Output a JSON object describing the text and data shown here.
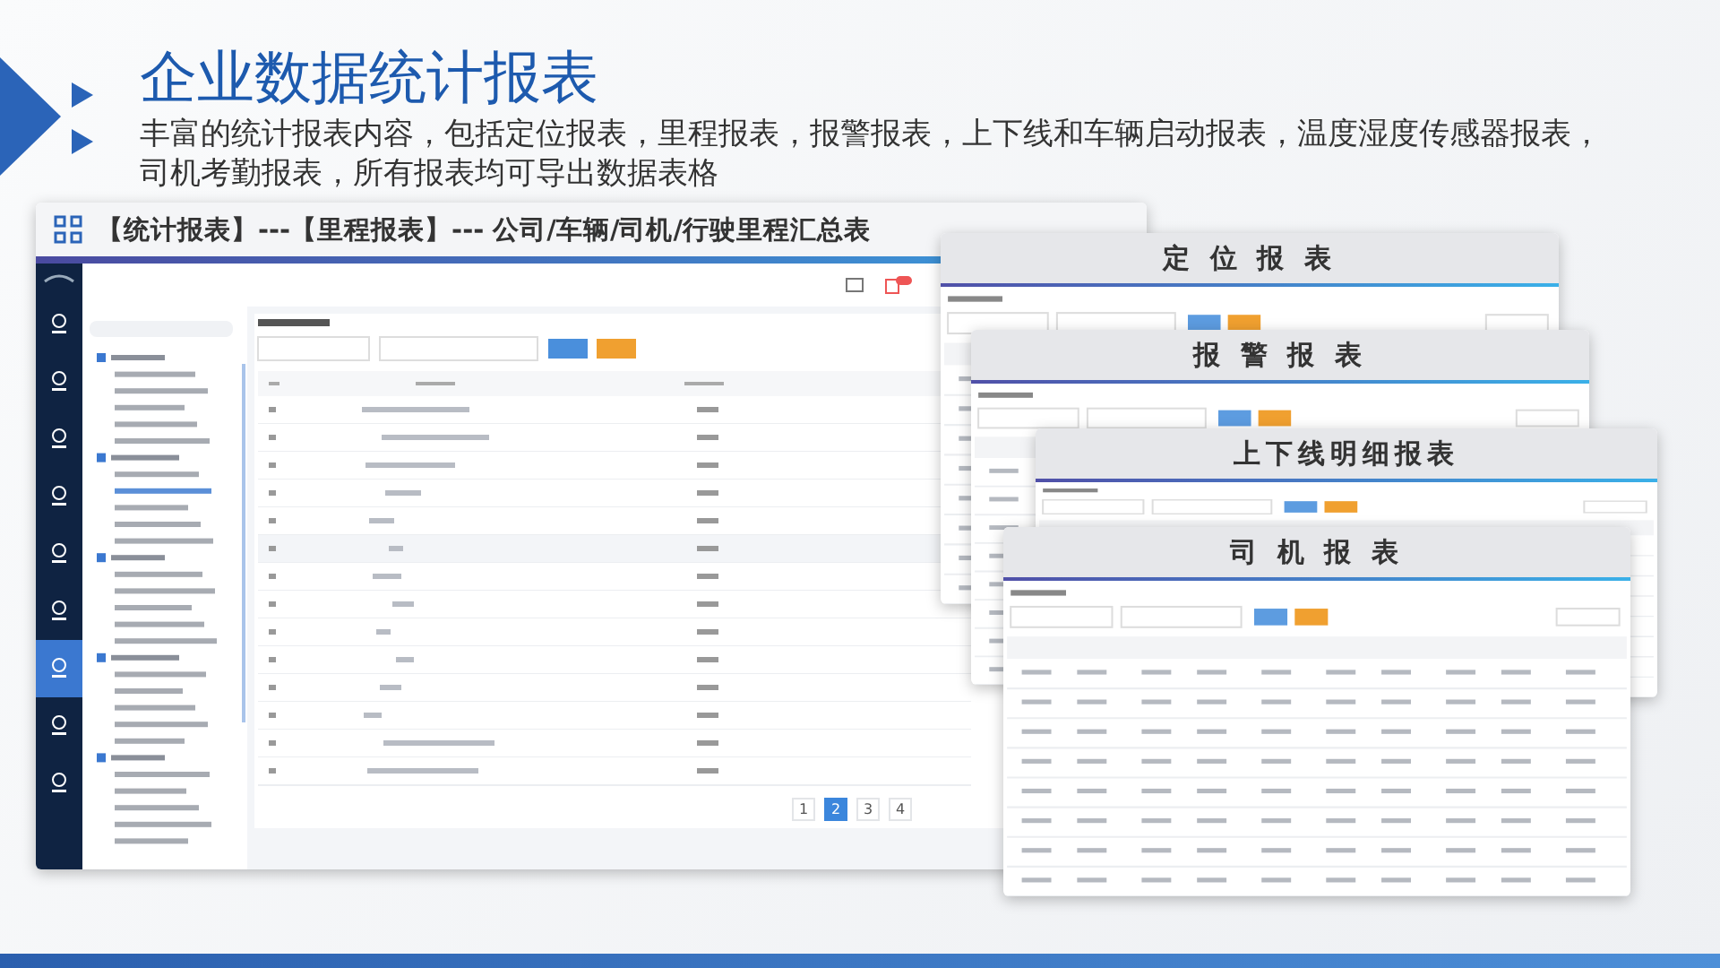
{
  "slide": {
    "title": "企业数据统计报表",
    "description": "丰富的统计报表内容，包括定位报表，里程报表，报警报表，上下线和车辆启动报表，温度湿度传感器报表，司机考勤报表，所有报表均可导出数据表格"
  },
  "main_window": {
    "title": "【统计报表】---【里程报表】--- 公司/车辆/司机/行驶里程汇总表",
    "sidebar_nav": [
      {
        "selected": false
      },
      {
        "selected": false
      },
      {
        "selected": false
      },
      {
        "selected": false
      },
      {
        "selected": false
      },
      {
        "selected": false
      },
      {
        "selected": true
      },
      {
        "selected": false
      },
      {
        "selected": false
      }
    ],
    "pagination": [
      {
        "label": "1",
        "selected": false
      },
      {
        "label": "2",
        "selected": true
      },
      {
        "label": "3",
        "selected": false
      },
      {
        "label": "4",
        "selected": false
      }
    ]
  },
  "report_cards": [
    {
      "title": "定 位 报 表"
    },
    {
      "title": "报 警 报 表"
    },
    {
      "title": "上下线明细报表"
    },
    {
      "title": "司 机 报 表"
    }
  ]
}
